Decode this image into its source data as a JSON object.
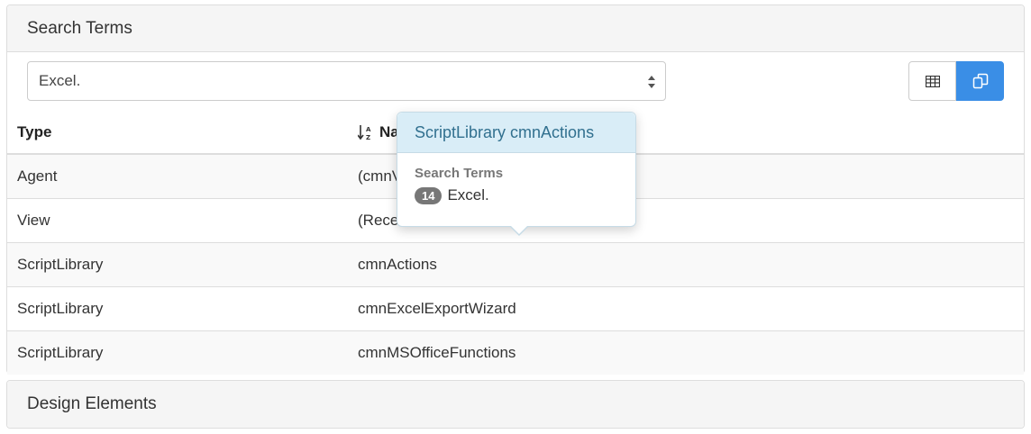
{
  "search_panel": {
    "heading": "Search Terms",
    "select_value": "Excel.",
    "view_buttons": [
      {
        "icon": "table-icon",
        "active": false
      },
      {
        "icon": "copy-icon",
        "active": true
      }
    ]
  },
  "table": {
    "columns": [
      "Type",
      "Na"
    ],
    "rows": [
      {
        "type": "Agent",
        "name": "(cmnV"
      },
      {
        "type": "View",
        "name": "(Rece"
      },
      {
        "type": "ScriptLibrary",
        "name": "cmnActions"
      },
      {
        "type": "ScriptLibrary",
        "name": "cmnExcelExportWizard"
      },
      {
        "type": "ScriptLibrary",
        "name": "cmnMSOfficeFunctions"
      }
    ]
  },
  "popover": {
    "title": "ScriptLibrary cmnActions",
    "label": "Search Terms",
    "count": "14",
    "term": "Excel."
  },
  "design_panel": {
    "heading": "Design Elements"
  },
  "colors": {
    "accent": "#3a8ee6",
    "popover_title_bg": "#d9edf7",
    "popover_title_text": "#31708f"
  }
}
